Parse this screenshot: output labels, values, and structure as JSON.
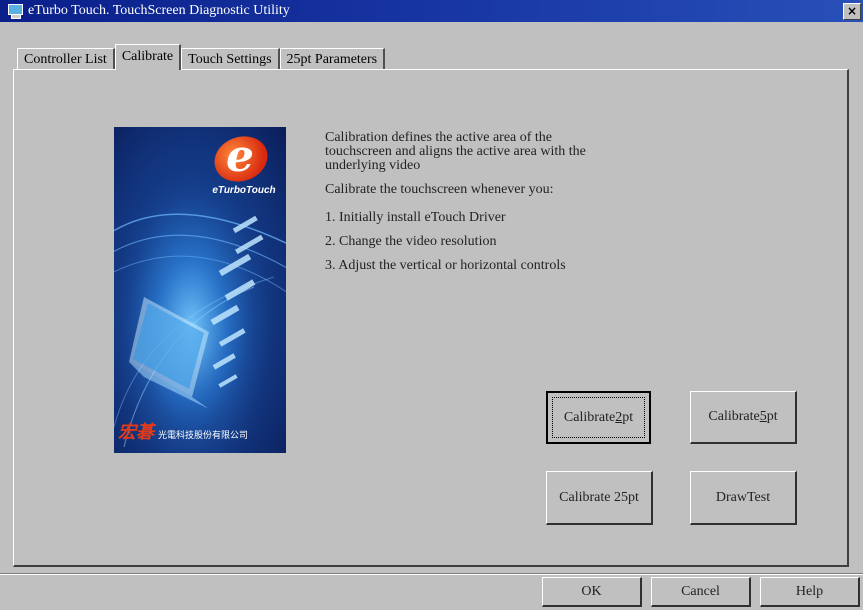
{
  "window": {
    "title": "eTurbo Touch. TouchScreen Diagnostic Utility",
    "close_symbol": "×",
    "icon": "touch-monitor-icon"
  },
  "tabs": [
    {
      "label": "Controller List",
      "active": false
    },
    {
      "label": "Calibrate",
      "active": true
    },
    {
      "label": "Touch Settings",
      "active": false
    },
    {
      "label": "25pt Parameters",
      "active": false
    }
  ],
  "splash": {
    "logo_letter": "e",
    "brand": "eTurboTouch",
    "company": "光電科技股份有限公司",
    "company_logo": "宏碁"
  },
  "description": {
    "para1": "Calibration defines the active area of the touchscreen and aligns the active area with the underlying video",
    "para2": "Calibrate the touchscreen whenever you:",
    "steps": [
      "1. Initially install eTouch Driver",
      "2. Change the video resolution",
      "3. Adjust the vertical or horizontal controls"
    ]
  },
  "buttons": {
    "calibrate_2pt_pre": "Calibrate ",
    "calibrate_2pt_key": "2",
    "calibrate_2pt_post": "pt",
    "calibrate_5pt_pre": "Calibrate ",
    "calibrate_5pt_key": "5",
    "calibrate_5pt_post": "pt",
    "calibrate_25pt": "Calibrate 25pt",
    "draw_test": "DrawTest"
  },
  "dialog_buttons": {
    "ok": "OK",
    "cancel": "Cancel",
    "help": "Help"
  },
  "colors": {
    "titlebar": "#0a1f8a",
    "face": "#c0c0c0",
    "splash_bg": "#15408f",
    "logo_red": "#e03a1a"
  }
}
